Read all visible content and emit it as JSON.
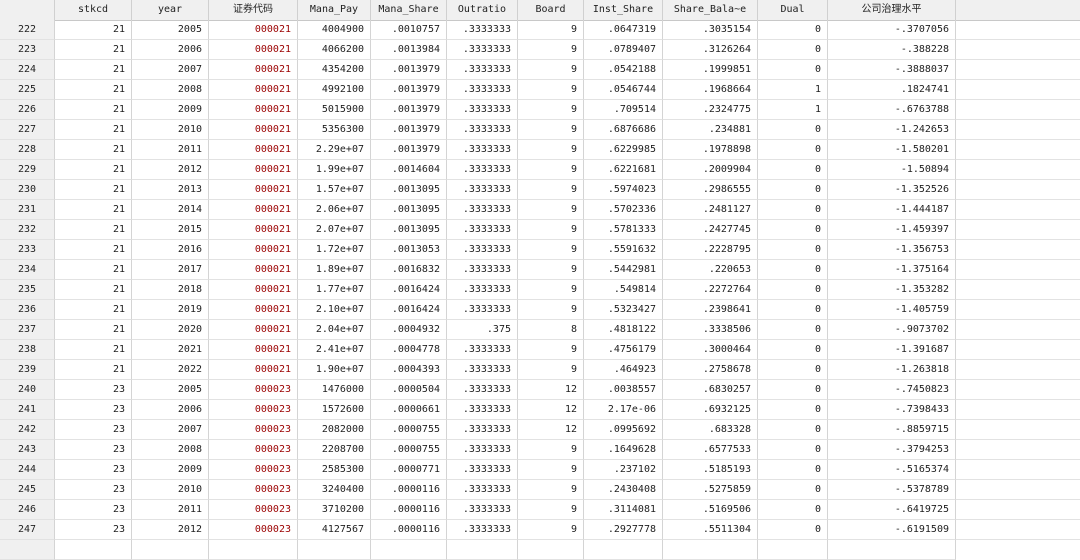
{
  "columns": [
    "",
    "stkcd",
    "year",
    "证券代码",
    "Mana_Pay",
    "Mana_Share",
    "Outratio",
    "Board",
    "Inst_Share",
    "Share_Bala~e",
    "Dual",
    "公司治理水平"
  ],
  "rows": [
    [
      "222",
      "21",
      "2005",
      "000021",
      "4004900",
      ".0010757",
      ".3333333",
      "9",
      ".0647319",
      ".3035154",
      "0",
      "-.3707056"
    ],
    [
      "223",
      "21",
      "2006",
      "000021",
      "4066200",
      ".0013984",
      ".3333333",
      "9",
      ".0789407",
      ".3126264",
      "0",
      "-.388228"
    ],
    [
      "224",
      "21",
      "2007",
      "000021",
      "4354200",
      ".0013979",
      ".3333333",
      "9",
      ".0542188",
      ".1999851",
      "0",
      "-.3888037"
    ],
    [
      "225",
      "21",
      "2008",
      "000021",
      "4992100",
      ".0013979",
      ".3333333",
      "9",
      ".0546744",
      ".1968664",
      "1",
      ".1824741"
    ],
    [
      "226",
      "21",
      "2009",
      "000021",
      "5015900",
      ".0013979",
      ".3333333",
      "9",
      ".709514",
      ".2324775",
      "1",
      "-.6763788"
    ],
    [
      "227",
      "21",
      "2010",
      "000021",
      "5356300",
      ".0013979",
      ".3333333",
      "9",
      ".6876686",
      ".234881",
      "0",
      "-1.242653"
    ],
    [
      "228",
      "21",
      "2011",
      "000021",
      "2.29e+07",
      ".0013979",
      ".3333333",
      "9",
      ".6229985",
      ".1978898",
      "0",
      "-1.580201"
    ],
    [
      "229",
      "21",
      "2012",
      "000021",
      "1.99e+07",
      ".0014604",
      ".3333333",
      "9",
      ".6221681",
      ".2009904",
      "0",
      "-1.50894"
    ],
    [
      "230",
      "21",
      "2013",
      "000021",
      "1.57e+07",
      ".0013095",
      ".3333333",
      "9",
      ".5974023",
      ".2986555",
      "0",
      "-1.352526"
    ],
    [
      "231",
      "21",
      "2014",
      "000021",
      "2.06e+07",
      ".0013095",
      ".3333333",
      "9",
      ".5702336",
      ".2481127",
      "0",
      "-1.444187"
    ],
    [
      "232",
      "21",
      "2015",
      "000021",
      "2.07e+07",
      ".0013095",
      ".3333333",
      "9",
      ".5781333",
      ".2427745",
      "0",
      "-1.459397"
    ],
    [
      "233",
      "21",
      "2016",
      "000021",
      "1.72e+07",
      ".0013053",
      ".3333333",
      "9",
      ".5591632",
      ".2228795",
      "0",
      "-1.356753"
    ],
    [
      "234",
      "21",
      "2017",
      "000021",
      "1.89e+07",
      ".0016832",
      ".3333333",
      "9",
      ".5442981",
      ".220653",
      "0",
      "-1.375164"
    ],
    [
      "235",
      "21",
      "2018",
      "000021",
      "1.77e+07",
      ".0016424",
      ".3333333",
      "9",
      ".549814",
      ".2272764",
      "0",
      "-1.353282"
    ],
    [
      "236",
      "21",
      "2019",
      "000021",
      "2.10e+07",
      ".0016424",
      ".3333333",
      "9",
      ".5323427",
      ".2398641",
      "0",
      "-1.405759"
    ],
    [
      "237",
      "21",
      "2020",
      "000021",
      "2.04e+07",
      ".0004932",
      ".375",
      "8",
      ".4818122",
      ".3338506",
      "0",
      "-.9073702"
    ],
    [
      "238",
      "21",
      "2021",
      "000021",
      "2.41e+07",
      ".0004778",
      ".3333333",
      "9",
      ".4756179",
      ".3000464",
      "0",
      "-1.391687"
    ],
    [
      "239",
      "21",
      "2022",
      "000021",
      "1.90e+07",
      ".0004393",
      ".3333333",
      "9",
      ".464923",
      ".2758678",
      "0",
      "-1.263818"
    ],
    [
      "240",
      "23",
      "2005",
      "000023",
      "1476000",
      ".0000504",
      ".3333333",
      "12",
      ".0038557",
      ".6830257",
      "0",
      "-.7450823"
    ],
    [
      "241",
      "23",
      "2006",
      "000023",
      "1572600",
      ".0000661",
      ".3333333",
      "12",
      "2.17e-06",
      ".6932125",
      "0",
      "-.7398433"
    ],
    [
      "242",
      "23",
      "2007",
      "000023",
      "2082000",
      ".0000755",
      ".3333333",
      "12",
      ".0995692",
      ".683328",
      "0",
      "-.8859715"
    ],
    [
      "243",
      "23",
      "2008",
      "000023",
      "2208700",
      ".0000755",
      ".3333333",
      "9",
      ".1649628",
      ".6577533",
      "0",
      "-.3794253"
    ],
    [
      "244",
      "23",
      "2009",
      "000023",
      "2585300",
      ".0000771",
      ".3333333",
      "9",
      ".237102",
      ".5185193",
      "0",
      "-.5165374"
    ],
    [
      "245",
      "23",
      "2010",
      "000023",
      "3240400",
      ".0000116",
      ".3333333",
      "9",
      ".2430408",
      ".5275859",
      "0",
      "-.5378789"
    ],
    [
      "246",
      "23",
      "2011",
      "000023",
      "3710200",
      ".0000116",
      ".3333333",
      "9",
      ".3114081",
      ".5169506",
      "0",
      "-.6419725"
    ],
    [
      "247",
      "23",
      "2012",
      "000023",
      "4127567",
      ".0000116",
      ".3333333",
      "9",
      ".2927778",
      ".5511304",
      "0",
      "-.6191509"
    ]
  ]
}
